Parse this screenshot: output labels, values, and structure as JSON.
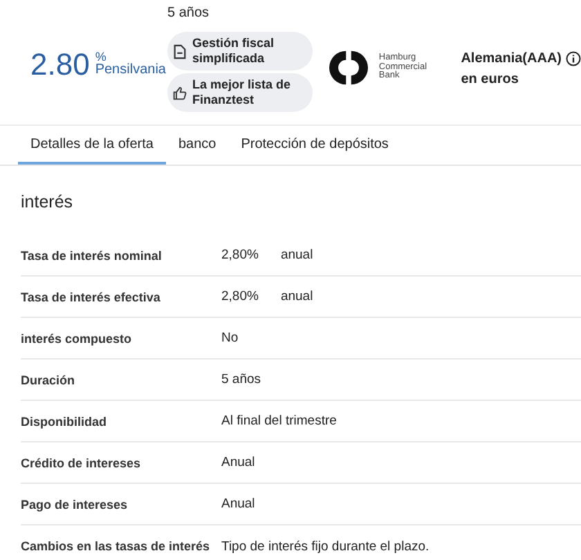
{
  "offer": {
    "rate": "2.80",
    "rate_unit": "%",
    "rate_label": "Pensilvania",
    "term": "5 años",
    "badges": [
      {
        "kind": "document",
        "text": "Gestión fiscal simplificada"
      },
      {
        "kind": "thumb",
        "text": "La mejor lista de Finanztest"
      }
    ],
    "bank_logo": {
      "lines": [
        "Hamburg",
        "Commercial",
        "Bank"
      ]
    },
    "country": "Alemania(AAA)",
    "currency": "en euros"
  },
  "tabs": [
    {
      "label": "Detalles de la oferta",
      "selected": true
    },
    {
      "label": "banco",
      "selected": false
    },
    {
      "label": "Protección de depósitos",
      "selected": false
    }
  ],
  "section_title": "interés",
  "rows": [
    {
      "label": "Tasa de interés nominal",
      "value": "2,80%",
      "unit": "anual"
    },
    {
      "label": "Tasa de interés efectiva",
      "value": "2,80%",
      "unit": "anual"
    },
    {
      "label": "interés compuesto",
      "value": "No"
    },
    {
      "label": "Duración",
      "value": "5 años"
    },
    {
      "label": "Disponibilidad",
      "value": "Al final del trimestre"
    },
    {
      "label": "Crédito de intereses",
      "value": "Anual"
    },
    {
      "label": "Pago de intereses",
      "value": "Anual"
    },
    {
      "label": "Cambios en las tasas de interés",
      "value": "Tipo de interés fijo durante el plazo."
    }
  ]
}
